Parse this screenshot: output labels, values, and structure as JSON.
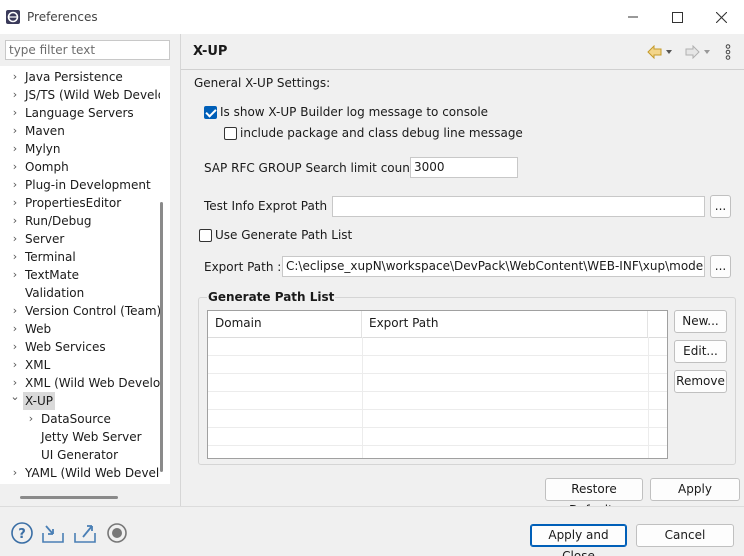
{
  "window": {
    "title": "Preferences"
  },
  "filter": {
    "placeholder": "type filter text"
  },
  "tree": [
    {
      "label": "Java Persistence",
      "indent": 0,
      "arrow": "›"
    },
    {
      "label": "JS/TS (Wild Web Develo",
      "indent": 0,
      "arrow": "›"
    },
    {
      "label": "Language Servers",
      "indent": 0,
      "arrow": "›"
    },
    {
      "label": "Maven",
      "indent": 0,
      "arrow": "›"
    },
    {
      "label": "Mylyn",
      "indent": 0,
      "arrow": "›"
    },
    {
      "label": "Oomph",
      "indent": 0,
      "arrow": "›"
    },
    {
      "label": "Plug-in Development",
      "indent": 0,
      "arrow": "›"
    },
    {
      "label": "PropertiesEditor",
      "indent": 0,
      "arrow": "›"
    },
    {
      "label": "Run/Debug",
      "indent": 0,
      "arrow": "›"
    },
    {
      "label": "Server",
      "indent": 0,
      "arrow": "›"
    },
    {
      "label": "Terminal",
      "indent": 0,
      "arrow": "›"
    },
    {
      "label": "TextMate",
      "indent": 0,
      "arrow": "›"
    },
    {
      "label": "Validation",
      "indent": 0,
      "arrow": ""
    },
    {
      "label": "Version Control (Team)",
      "indent": 0,
      "arrow": "›"
    },
    {
      "label": "Web",
      "indent": 0,
      "arrow": "›"
    },
    {
      "label": "Web Services",
      "indent": 0,
      "arrow": "›"
    },
    {
      "label": "XML",
      "indent": 0,
      "arrow": "›"
    },
    {
      "label": "XML (Wild Web Develop",
      "indent": 0,
      "arrow": "›"
    },
    {
      "label": "X-UP",
      "indent": 0,
      "arrow": "⌄",
      "selected": true
    },
    {
      "label": "DataSource",
      "indent": 1,
      "arrow": "›"
    },
    {
      "label": "Jetty Web Server",
      "indent": 1,
      "arrow": ""
    },
    {
      "label": "UI Generator",
      "indent": 1,
      "arrow": ""
    },
    {
      "label": "YAML (Wild Web Develo",
      "indent": 0,
      "arrow": "›"
    }
  ],
  "page": {
    "title": "X-UP",
    "general_label": "General X-UP Settings:",
    "log_checkbox_label": "Is show X-UP Builder log message to console",
    "debug_checkbox_label": "include package and class debug line message",
    "limit_label": "SAP RFC GROUP Search limit count :",
    "limit_value": "3000",
    "test_path_label": "Test Info Exprot Path :",
    "test_path_value": "",
    "browse_label": "...",
    "use_path_label": "Use Generate Path List",
    "export_label": "Export Path :",
    "export_value": "C:\\eclipse_xupN\\workspace\\DevPack\\WebContent\\WEB-INF\\xup\\model",
    "group_title": "Generate Path List",
    "columns": [
      "Domain",
      "Export Path"
    ],
    "new_button": "New...",
    "edit_button": "Edit...",
    "remove_button": "Remove",
    "restore_button": "Restore Defaults",
    "apply_button": "Apply"
  },
  "footer": {
    "apply_close": "Apply and Close",
    "cancel": "Cancel"
  },
  "colors": {
    "accent": "#005fb8",
    "selection": "#d9d9d9"
  }
}
